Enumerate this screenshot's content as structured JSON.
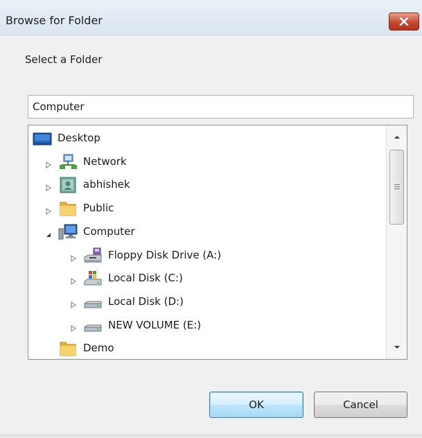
{
  "window": {
    "title": "Browse for Folder",
    "instruction": "Select a Folder"
  },
  "path_input": {
    "value": "Computer"
  },
  "tree": {
    "items": [
      {
        "label": "Desktop",
        "icon": "desktop-icon",
        "level": 0,
        "expander": "none"
      },
      {
        "label": "Network",
        "icon": "network-icon",
        "level": 1,
        "expander": "collapsed"
      },
      {
        "label": "abhishek",
        "icon": "user-folder-icon",
        "level": 1,
        "expander": "collapsed"
      },
      {
        "label": "Public",
        "icon": "folder-icon",
        "level": 1,
        "expander": "collapsed"
      },
      {
        "label": "Computer",
        "icon": "computer-icon",
        "level": 1,
        "expander": "expanded"
      },
      {
        "label": "Floppy Disk Drive (A:)",
        "icon": "floppy-drive-icon",
        "level": 2,
        "expander": "collapsed"
      },
      {
        "label": "Local Disk (C:)",
        "icon": "system-drive-icon",
        "level": 2,
        "expander": "collapsed"
      },
      {
        "label": "Local Disk (D:)",
        "icon": "hard-drive-icon",
        "level": 2,
        "expander": "collapsed"
      },
      {
        "label": "NEW VOLUME (E:)",
        "icon": "hard-drive-icon",
        "level": 2,
        "expander": "collapsed"
      },
      {
        "label": "Demo",
        "icon": "folder-icon",
        "level": 1,
        "expander": "none"
      }
    ]
  },
  "buttons": {
    "ok": "OK",
    "cancel": "Cancel"
  },
  "colors": {
    "titlebar": "#dbe6f1",
    "close_button": "#c8482e",
    "ok_button_border": "#3c7fb1",
    "folder": "#f0c24a"
  }
}
